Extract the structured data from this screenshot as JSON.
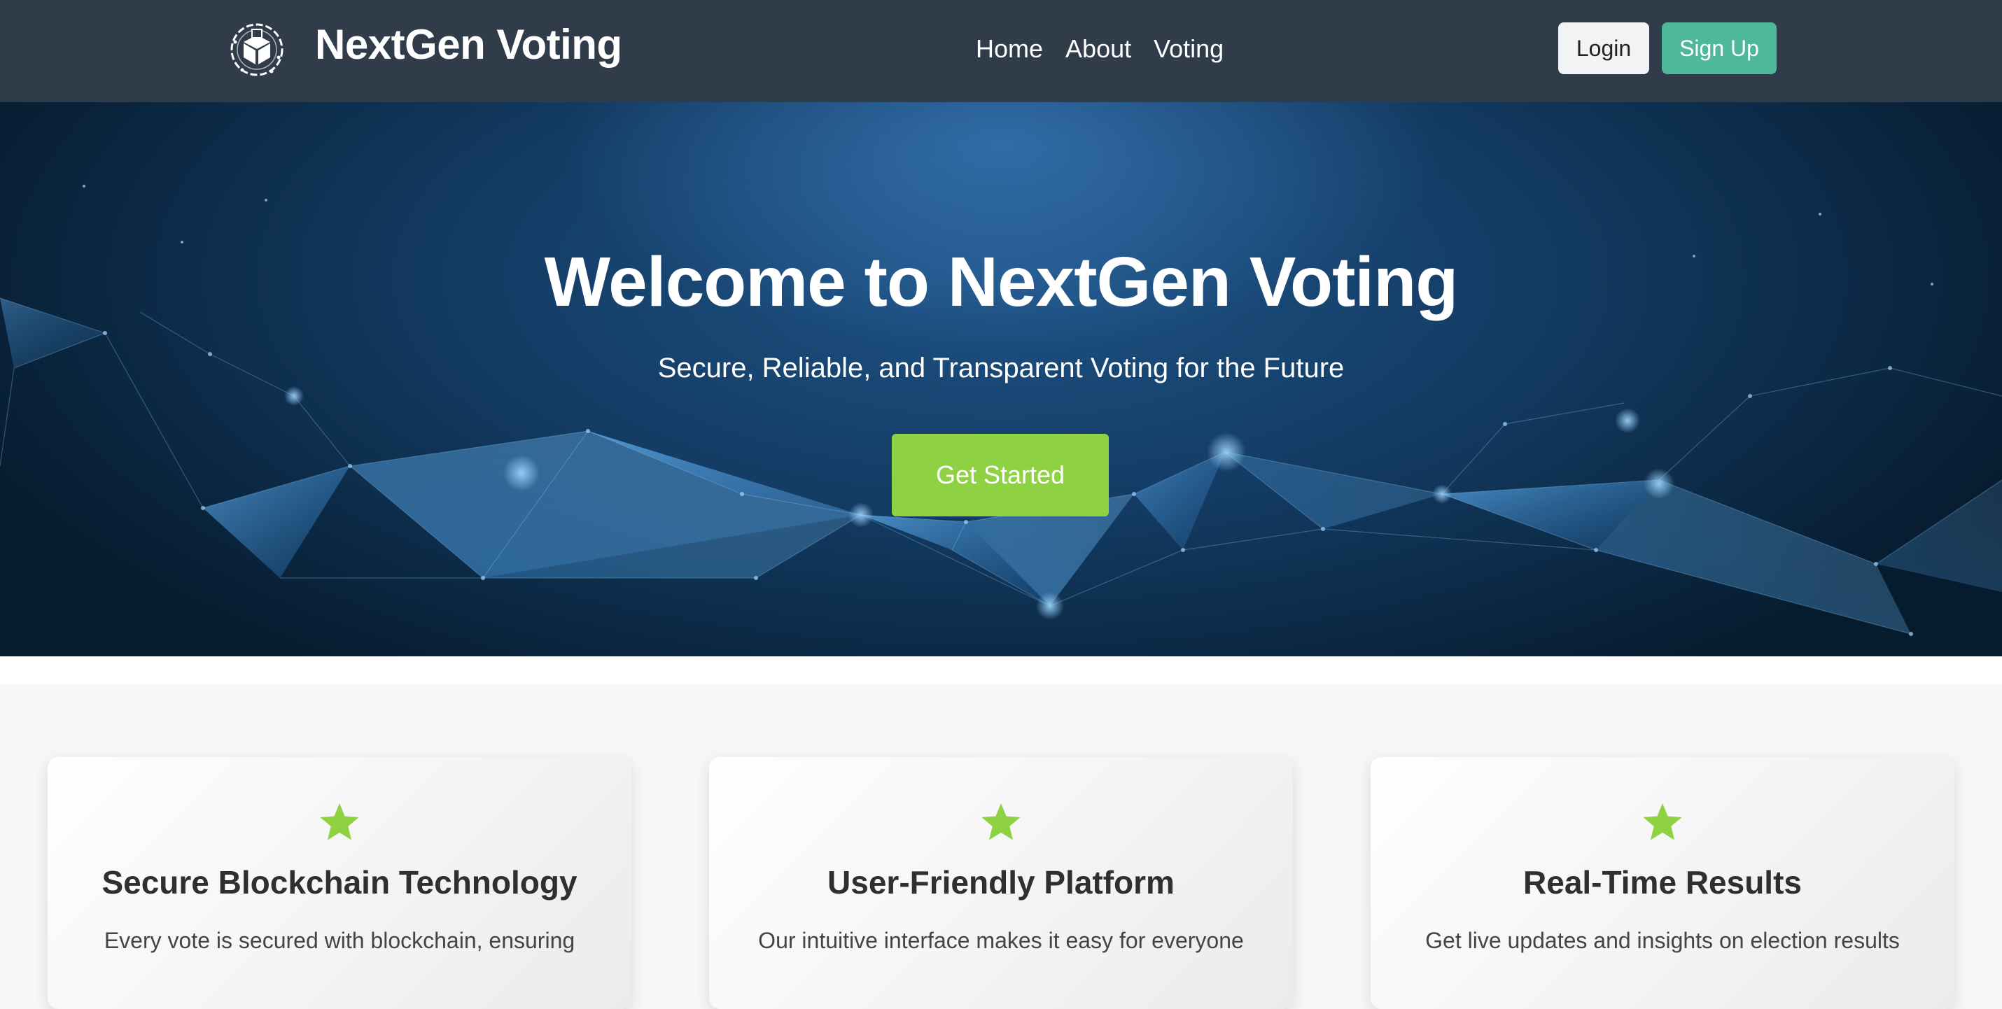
{
  "nav": {
    "brand": "NextGen Voting",
    "links": [
      "Home",
      "About",
      "Voting"
    ],
    "login_label": "Login",
    "signup_label": "Sign Up"
  },
  "hero": {
    "title": "Welcome to NextGen Voting",
    "subtitle": "Secure, Reliable, and Transparent Voting for the Future",
    "cta_label": "Get Started"
  },
  "features": [
    {
      "icon": "star-icon",
      "title": "Secure Blockchain Technology",
      "text": "Every vote is secured with blockchain, ensuring"
    },
    {
      "icon": "star-icon",
      "title": "User-Friendly Platform",
      "text": "Our intuitive interface makes it easy for everyone"
    },
    {
      "icon": "star-icon",
      "title": "Real-Time Results",
      "text": "Get live updates and insights on election results"
    }
  ],
  "colors": {
    "navbar": "#313c4b",
    "signup": "#4fb89a",
    "cta": "#8ed244",
    "star": "#8ed244"
  }
}
